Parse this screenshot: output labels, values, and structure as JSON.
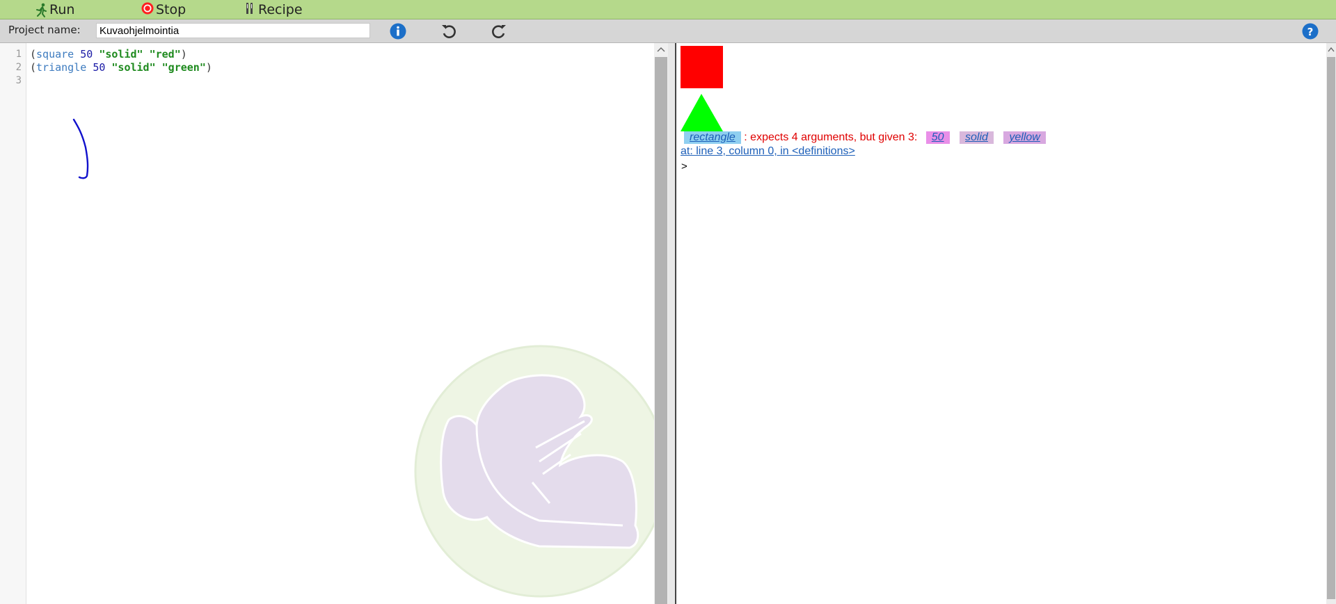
{
  "toolbar": {
    "run_label": "Run",
    "stop_label": "Stop",
    "recipe_label": "Recipe"
  },
  "project": {
    "label": "Project name:",
    "name_value": "Kuvaohjelmointia"
  },
  "icons": {
    "run": "running-figure-icon",
    "stop": "stop-icon",
    "recipe": "utensils-icon",
    "info": "info-icon",
    "undo": "undo-icon",
    "redo": "redo-icon",
    "help": "help-icon",
    "logo": "shoe-logo"
  },
  "editor": {
    "line_numbers": [
      "1",
      "2",
      "3"
    ],
    "lines": [
      {
        "open": "(",
        "fn": "square",
        "num": "50",
        "s1": "\"solid\"",
        "s2": "\"red\"",
        "close": ")"
      },
      {
        "open": "(",
        "fn": "triangle",
        "num": "50",
        "s1": "\"solid\"",
        "s2": "\"green\"",
        "close": ")"
      }
    ]
  },
  "repl": {
    "output_shapes": [
      {
        "shape": "square",
        "color": "#ff0000"
      },
      {
        "shape": "triangle",
        "color": "#00ff00"
      }
    ],
    "error": {
      "function": "rectangle",
      "message": ": expects 4 arguments, but given 3:",
      "args": [
        "50",
        "solid",
        "yellow"
      ],
      "location": "at: line 3, column 0, in <definitions>"
    },
    "prompt": ">"
  },
  "colors": {
    "toolbar_bg": "#b5d98b",
    "projbar_bg": "#d6d6d6",
    "error_red": "#e00000",
    "link_blue": "#1d5fb8",
    "chip_fn": "#8fcff0",
    "chip_num": "#e98fe8",
    "chip_str": "#d9b8dc",
    "chip_str2": "#d8a8e0",
    "ink_blue": "#1010cc",
    "logo_circle": "#eef5e4",
    "logo_shoe": "#e4dcec"
  }
}
